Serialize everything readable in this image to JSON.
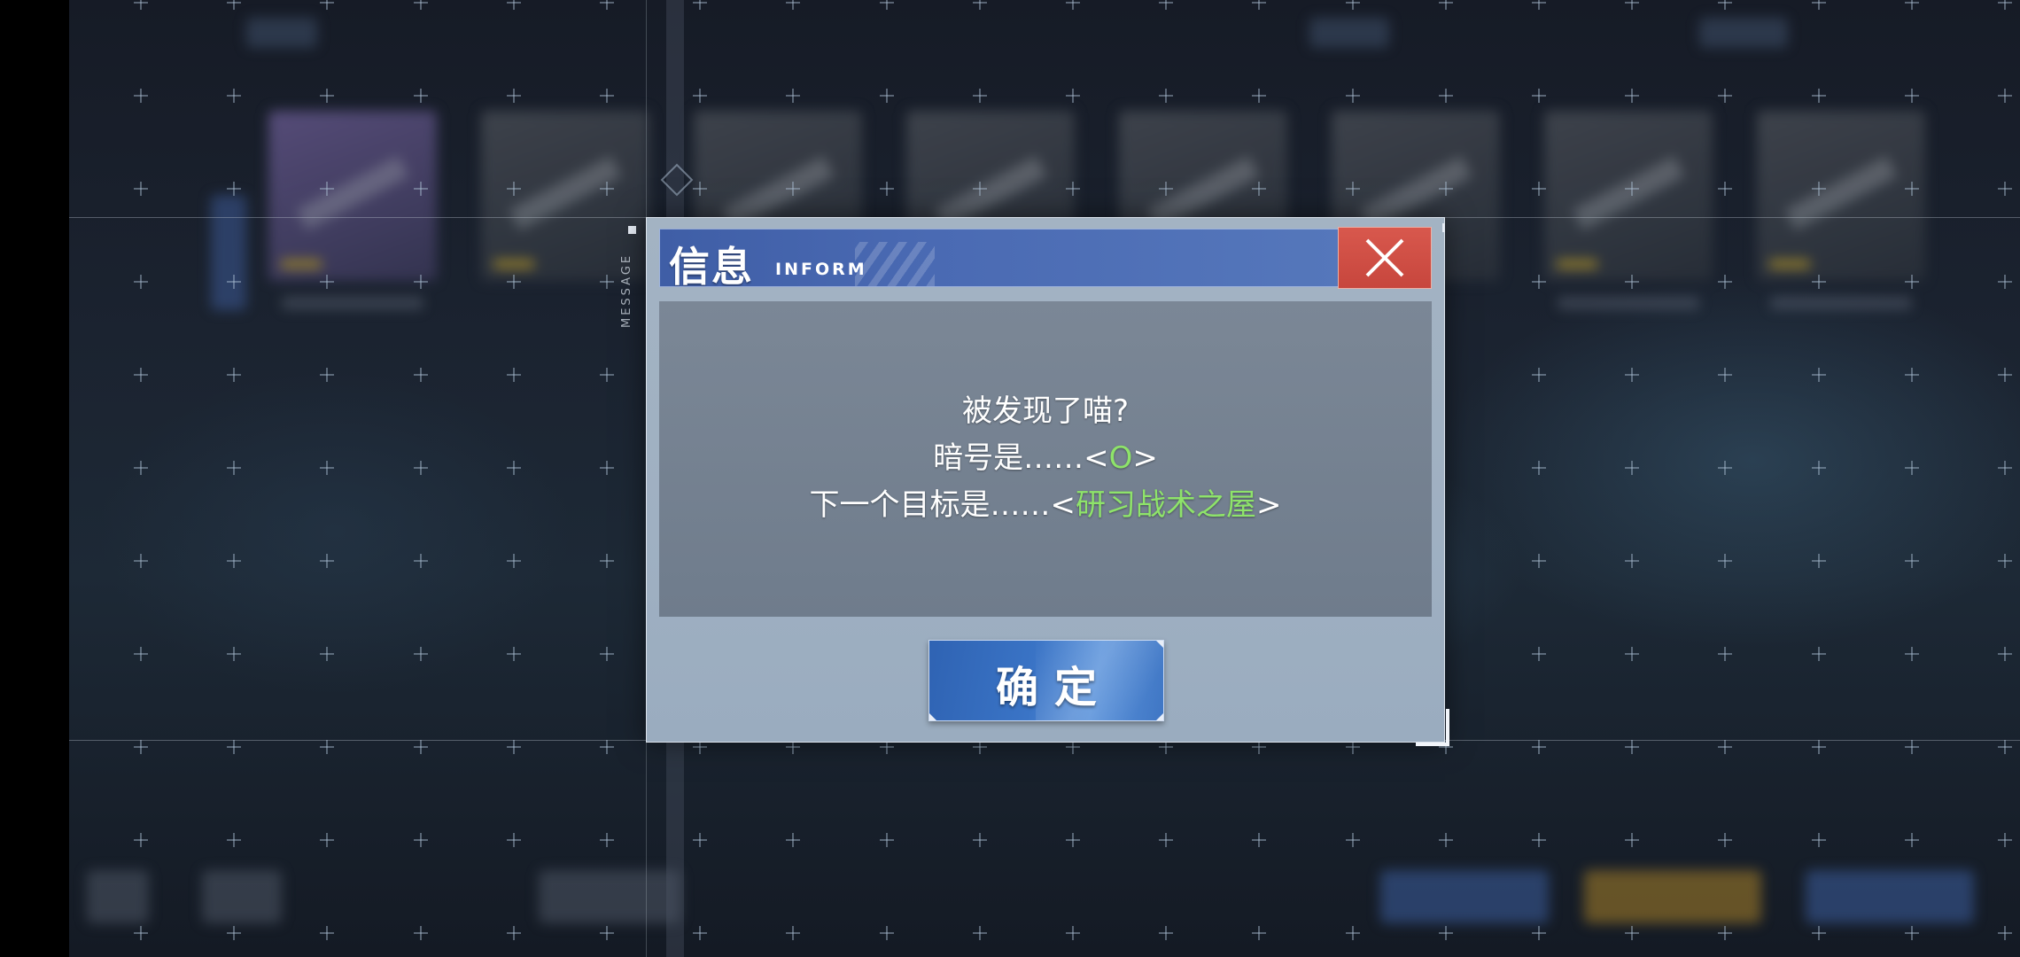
{
  "dialog": {
    "title": "信息",
    "title_sub": "INFORM",
    "side_label": "MESSAGE",
    "close_icon": "close-icon",
    "message": {
      "line1": "被发现了喵?",
      "line2_prefix": "暗号是……<",
      "line2_code": "O",
      "line2_suffix": ">",
      "line3_prefix": "下一个目标是……<",
      "line3_target": "研习战术之屋",
      "line3_suffix": ">"
    },
    "confirm_label": "确定"
  },
  "colors": {
    "title_bar": "#4a6ab3",
    "close_button": "#d0514a",
    "message_box": "#76828f",
    "highlight_text": "#8ee36a",
    "confirm_button": "#3a74c6"
  }
}
